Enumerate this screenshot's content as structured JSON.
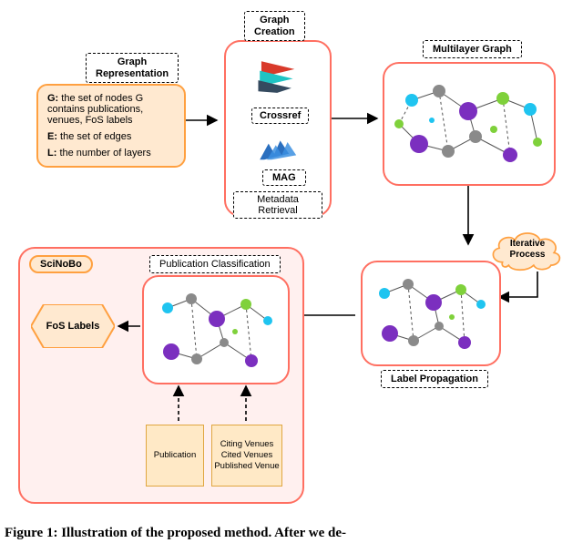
{
  "labels": {
    "graph_rep": "Graph\nRepresentation",
    "graph_creation": "Graph\nCreation",
    "multilayer": "Multilayer Graph",
    "pub_class": "Publication Classification",
    "metadata": "Metadata Retrieval",
    "label_prop": "Label Propagation",
    "scinobo": "SciNoBo",
    "iterative": "Iterative\nProcess"
  },
  "graph_rep_box": {
    "line1_bold": "G:",
    "line1": " the set of nodes G contains publications, venues, FoS labels",
    "line2_bold": "E:",
    "line2": " the set of edges",
    "line3_bold": "L:",
    "line3": " the number of layers"
  },
  "sources": {
    "crossref": "Crossref",
    "mag": "MAG"
  },
  "docs": {
    "publication": "Publication",
    "cv": "Citing Venues\nCited Venues\nPublished Venue"
  },
  "fos": "FoS Labels",
  "caption": "Figure 1: Illustration of the proposed method. After we de-"
}
